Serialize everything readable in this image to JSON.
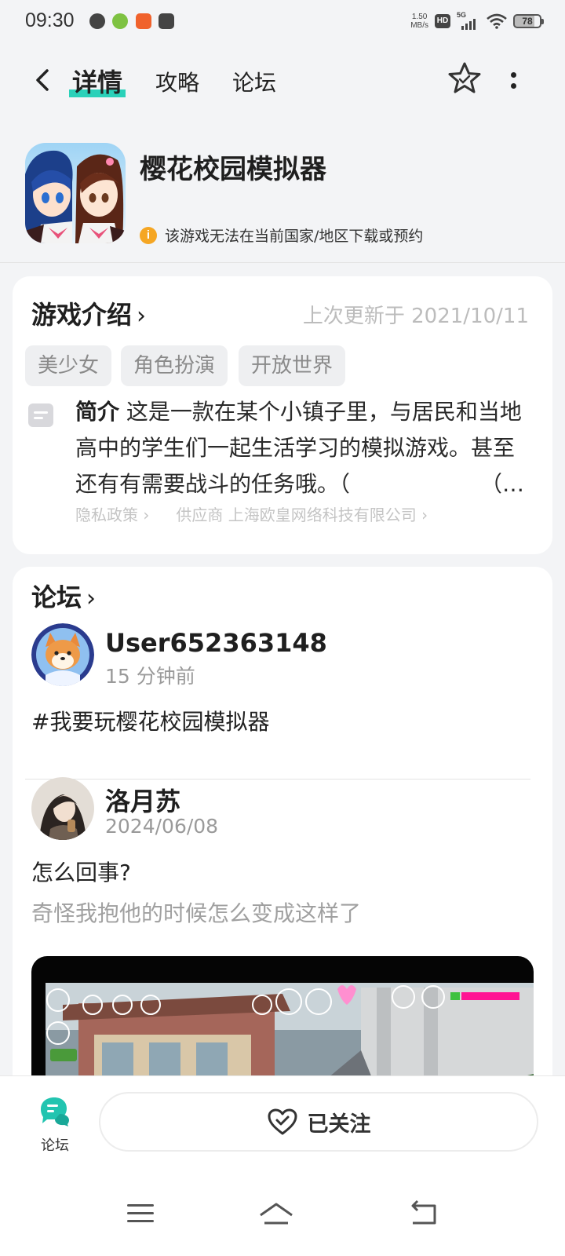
{
  "status_bar": {
    "time": "09:30",
    "net_speed_value": "1.50",
    "net_speed_unit": "MB/s",
    "hd_label": "HD",
    "network_label": "5G",
    "battery": "78"
  },
  "nav": {
    "tabs": [
      {
        "label": "详情",
        "active": true
      },
      {
        "label": "攻略",
        "active": false
      },
      {
        "label": "论坛",
        "active": false
      }
    ]
  },
  "app": {
    "title": "樱花校园模拟器",
    "warning": "该游戏无法在当前国家/地区下载或预约"
  },
  "intro": {
    "title": "游戏介绍",
    "chevron": "›",
    "updated": "上次更新于 2021/10/11",
    "tags": [
      "美少女",
      "角色扮演",
      "开放世界"
    ],
    "summary_label": "简介",
    "summary_text": "这是一款在某个小镇子里，与居民和当地高中的学生们一起生活学习的模拟游戏。甚至还有有需要战斗的任务哦。（",
    "ellipsis": "（…",
    "privacy": "隐私政策 ›",
    "supplier": "供应商 上海欧皇网络科技有限公司 ›"
  },
  "forum": {
    "title": "论坛",
    "chevron": "›",
    "posts": [
      {
        "user": "User652363148",
        "time": "15 分钟前",
        "text": "#我要玩樱花校园模拟器"
      },
      {
        "user": "洛月苏",
        "time": "2024/06/08",
        "text": "怎么回事?",
        "sub": "奇怪我抱他的时候怎么变成这样了"
      }
    ]
  },
  "bottom": {
    "forum_tab": "论坛",
    "follow_label": "已关注"
  },
  "colors": {
    "accent": "#2ad1b9",
    "warning": "#f5a623",
    "background": "#f3f4f6"
  }
}
